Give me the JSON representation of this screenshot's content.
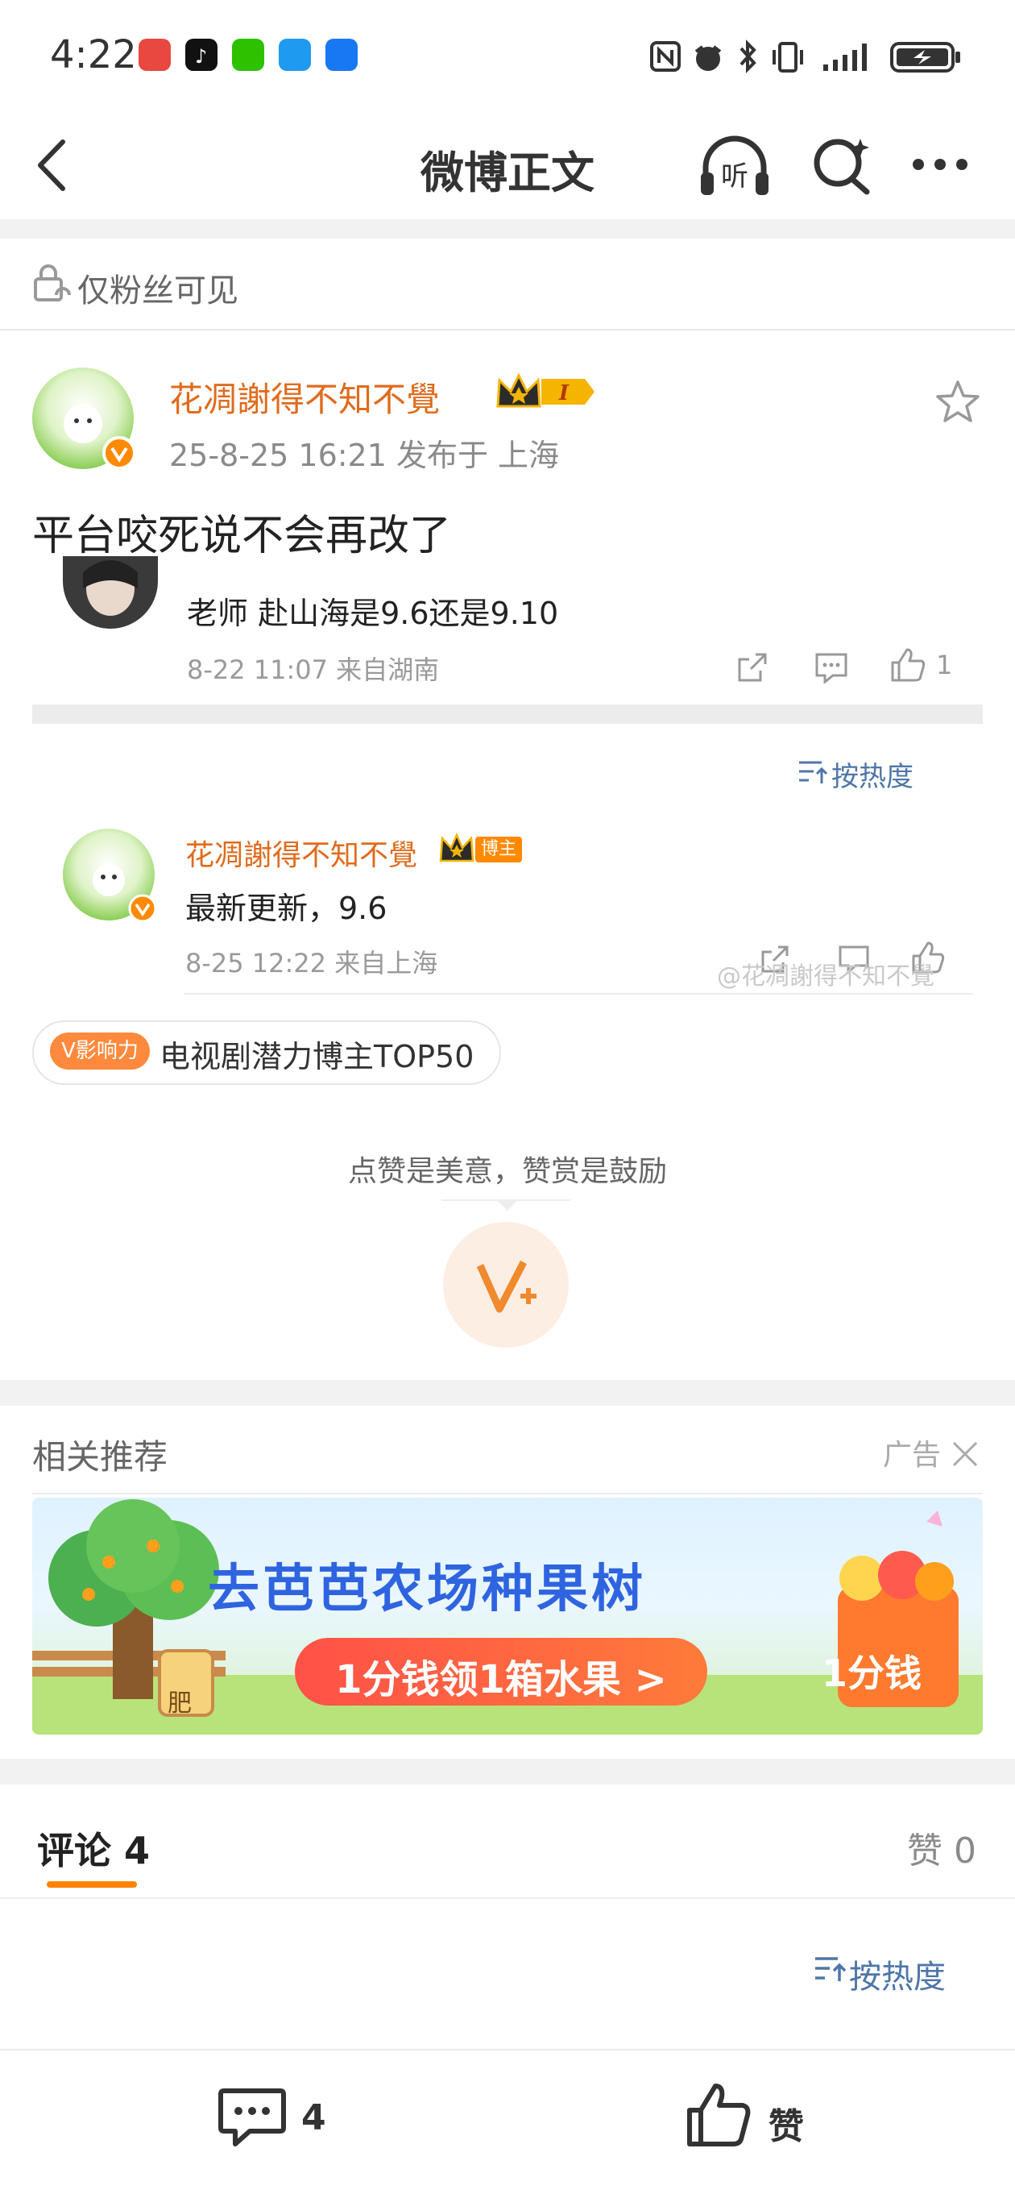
{
  "status_bar": {
    "time": "4:22",
    "apps": [
      "huawei-app-icon",
      "tiktok-app-icon",
      "wechat-app-icon",
      "messages-app-icon",
      "app-store-icon"
    ],
    "right_icons": [
      "nfc-icon",
      "alarm-icon",
      "bluetooth-icon",
      "vibrate-icon",
      "signal-icon",
      "battery-charging-icon"
    ]
  },
  "nav": {
    "title": "微博正文"
  },
  "visibility": {
    "text": "仅粉丝可见"
  },
  "post": {
    "author": "花凋謝得不知不覺",
    "meta": "25-8-25 16:21  发布于 上海",
    "text": "平台咬死说不会再改了"
  },
  "retweet_comment": {
    "text": "老师 赴山海是9.6还是9.10",
    "meta": "8-22 11:07  来自湖南",
    "like_count": "1"
  },
  "reply_section": {
    "sort_label": "按热度",
    "reply": {
      "name": "花凋謝得不知不覺",
      "badge": "博主",
      "text": "最新更新，9.6",
      "meta": "8-25 12:22  来自上海"
    },
    "watermark": "@花凋謝得不知不覺"
  },
  "influence": {
    "badge": "V影响力",
    "text": "电视剧潜力博主TOP50"
  },
  "reward": {
    "tip": "点赞是美意，赞赏是鼓励"
  },
  "recommend": {
    "title": "相关推荐",
    "ad_label": "广告",
    "ad": {
      "headline": "去芭芭农场种果树",
      "pill": "1分钱领1箱水果 >",
      "box": "1分钱",
      "tree_tag": "肥"
    }
  },
  "tabs": {
    "comments": "评论 4",
    "likes": "赞 0"
  },
  "comments_sort": "按热度",
  "bottom_bar": {
    "comment_count": "4",
    "like_label": "赞"
  },
  "colors": {
    "accent_orange": "#ff8200",
    "username_orange": "#e06b1d",
    "link_blue": "#4f76a8"
  }
}
